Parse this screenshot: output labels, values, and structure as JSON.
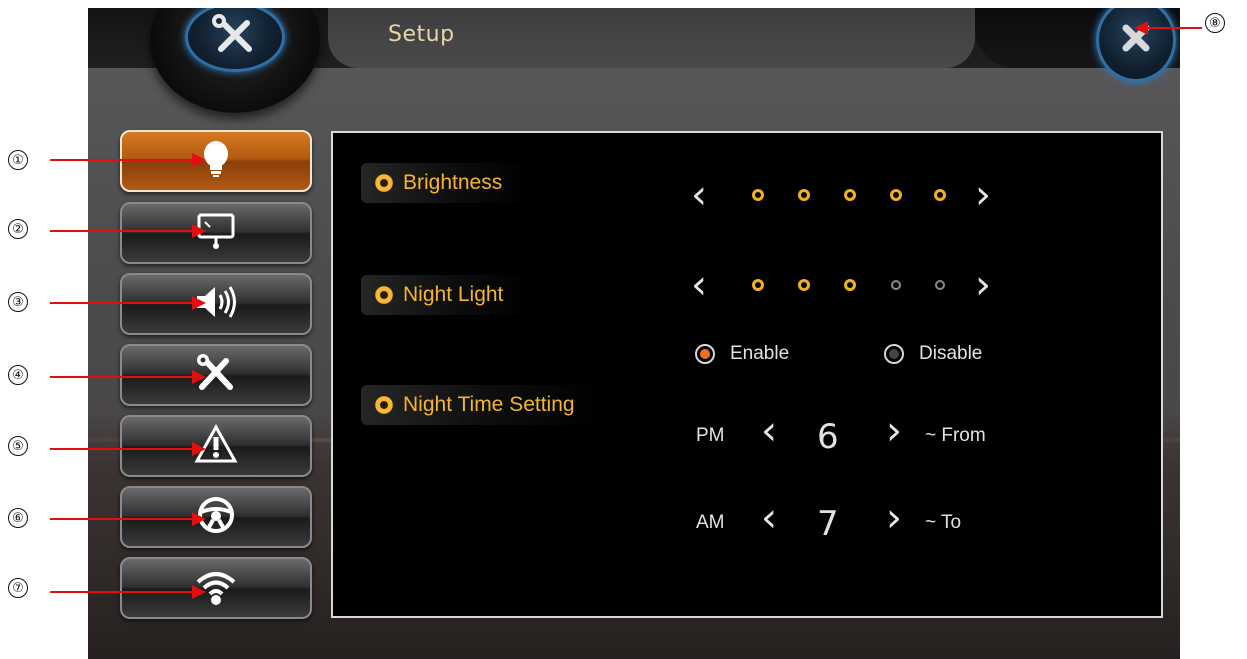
{
  "header": {
    "title": "Setup"
  },
  "sidebar": {
    "items": [
      {
        "name": "brightness",
        "icon": "lightbulb-icon",
        "active": true,
        "callout": "①"
      },
      {
        "name": "display",
        "icon": "screen-icon",
        "active": false,
        "callout": "②"
      },
      {
        "name": "sound",
        "icon": "speaker-icon",
        "active": false,
        "callout": "③"
      },
      {
        "name": "tools",
        "icon": "tools-icon",
        "active": false,
        "callout": "④"
      },
      {
        "name": "warning",
        "icon": "warning-icon",
        "active": false,
        "callout": "⑤"
      },
      {
        "name": "steering",
        "icon": "steering-wheel-icon",
        "active": false,
        "callout": "⑥"
      },
      {
        "name": "wireless",
        "icon": "wifi-icon",
        "active": false,
        "callout": "⑦"
      }
    ]
  },
  "close_callout": "⑧",
  "settings": {
    "brightness": {
      "label": "Brightness",
      "level": 5,
      "max": 5
    },
    "night_light": {
      "label": "Night Light",
      "level": 3,
      "max": 5
    },
    "night_time": {
      "label": "Night Time Setting",
      "enable_label": "Enable",
      "disable_label": "Disable",
      "selected": "Enable",
      "from": {
        "period": "PM",
        "hour": "6",
        "suffix": "~ From"
      },
      "to": {
        "period": "AM",
        "hour": "7",
        "suffix": "~ To"
      }
    }
  },
  "colors": {
    "accent": "#f3b020",
    "active_button": "#c0651a",
    "callout_red": "#e01010"
  }
}
